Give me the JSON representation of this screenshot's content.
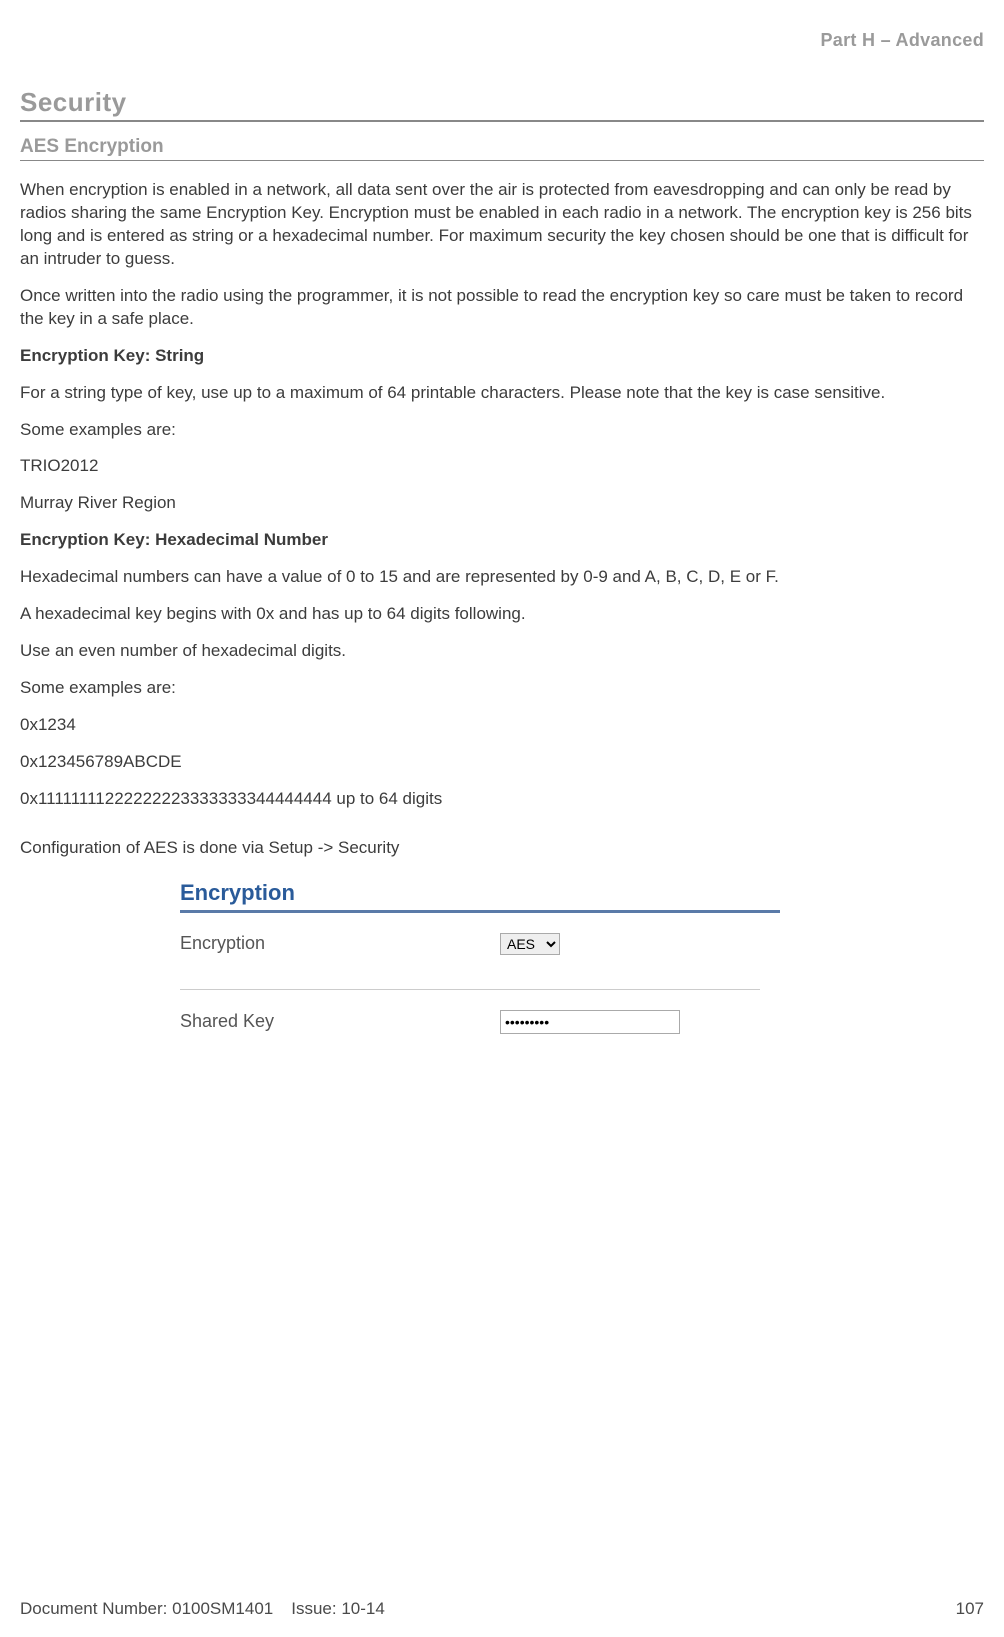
{
  "header": {
    "part": "Part H – Advanced"
  },
  "section": {
    "title": "Security",
    "subtitle": "AES Encryption"
  },
  "body": {
    "p1": "When encryption is enabled in a network, all data sent over the air is protected from eavesdropping and can only be read by radios sharing the same Encryption Key. Encryption must be enabled in each radio in a network. The encryption key is 256 bits long and is entered as string or a hexadecimal number. For maximum security the key chosen should be one that is difficult for an intruder to guess.",
    "p2": "Once written into the radio using the programmer, it is not possible to read the encryption key so care must be taken to record the key in a safe place.",
    "h_string": "Encryption Key: String",
    "p3": "For a string type of key, use up to a maximum of 64 printable characters. Please note that the key is case sensitive.",
    "p4": "Some examples are:",
    "ex1": "TRIO2012",
    "ex2": "Murray River Region",
    "h_hex": "Encryption Key: Hexadecimal Number",
    "p5": "Hexadecimal numbers can have a value of 0 to 15 and are represented by 0-9 and A, B, C, D, E or F.",
    "p6": "A hexadecimal key begins with 0x and has up to 64 digits following.",
    "p7": "Use an even number of hexadecimal digits.",
    "p8": "Some examples are:",
    "hx1": "0x1234",
    "hx2": "0x123456789ABCDE",
    "hx3": "0x11111111222222223333333344444444 up to 64 digits",
    "p9": "Configuration of AES is done via Setup -> Security"
  },
  "config": {
    "panel_title": "Encryption",
    "encryption_label": "Encryption",
    "encryption_value": "AES",
    "sharedkey_label": "Shared Key",
    "sharedkey_value": "•••••••••"
  },
  "footer": {
    "docnum": "Document Number: 0100SM1401",
    "issue": "Issue: 10-14",
    "page": "107"
  }
}
